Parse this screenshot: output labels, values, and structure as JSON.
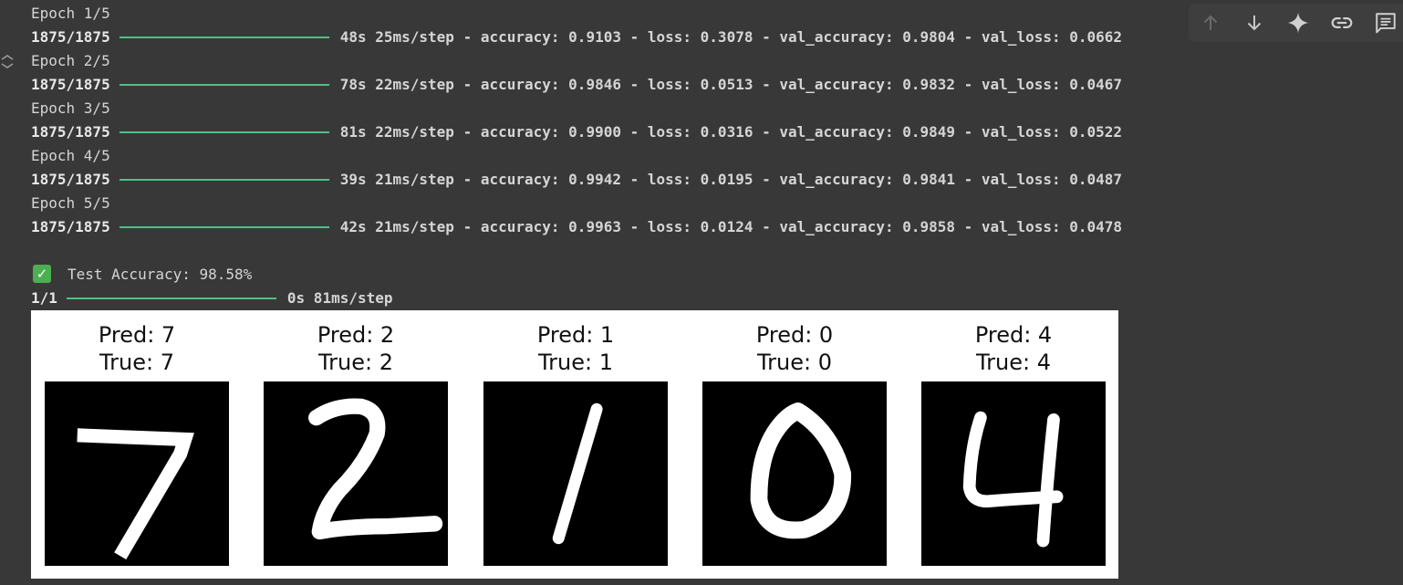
{
  "training_log": {
    "epochs": [
      {
        "label": "Epoch 1/5",
        "steps": "1875/1875",
        "timing": "48s 25ms/step",
        "metrics": "- accuracy: 0.9103 - loss: 0.3078 - val_accuracy: 0.9804 - val_loss: 0.0662"
      },
      {
        "label": "Epoch 2/5",
        "steps": "1875/1875",
        "timing": "78s 22ms/step",
        "metrics": "- accuracy: 0.9846 - loss: 0.0513 - val_accuracy: 0.9832 - val_loss: 0.0467"
      },
      {
        "label": "Epoch 3/5",
        "steps": "1875/1875",
        "timing": "81s 22ms/step",
        "metrics": "- accuracy: 0.9900 - loss: 0.0316 - val_accuracy: 0.9849 - val_loss: 0.0522"
      },
      {
        "label": "Epoch 4/5",
        "steps": "1875/1875",
        "timing": "39s 21ms/step",
        "metrics": "- accuracy: 0.9942 - loss: 0.0195 - val_accuracy: 0.9841 - val_loss: 0.0487"
      },
      {
        "label": "Epoch 5/5",
        "steps": "1875/1875",
        "timing": "42s 21ms/step",
        "metrics": "- accuracy: 0.9963 - loss: 0.0124 - val_accuracy: 0.9858 - val_loss: 0.0478"
      }
    ],
    "progress_color": "#4fbf87"
  },
  "test_result": {
    "check_glyph": "✓",
    "text": "Test Accuracy: 98.58%"
  },
  "predict_step": {
    "steps": "1/1",
    "timing": "0s 81ms/step"
  },
  "predictions": [
    {
      "pred": "Pred: 7",
      "true": "True: 7",
      "digit": "7"
    },
    {
      "pred": "Pred: 2",
      "true": "True: 2",
      "digit": "2"
    },
    {
      "pred": "Pred: 1",
      "true": "True: 1",
      "digit": "1"
    },
    {
      "pred": "Pred: 0",
      "true": "True: 0",
      "digit": "0"
    },
    {
      "pred": "Pred: 4",
      "true": "True: 4",
      "digit": "4"
    }
  ],
  "toolbar": {
    "icons": [
      "arrow-up-icon",
      "arrow-down-icon",
      "sparkle-icon",
      "link-icon",
      "comment-icon"
    ]
  }
}
